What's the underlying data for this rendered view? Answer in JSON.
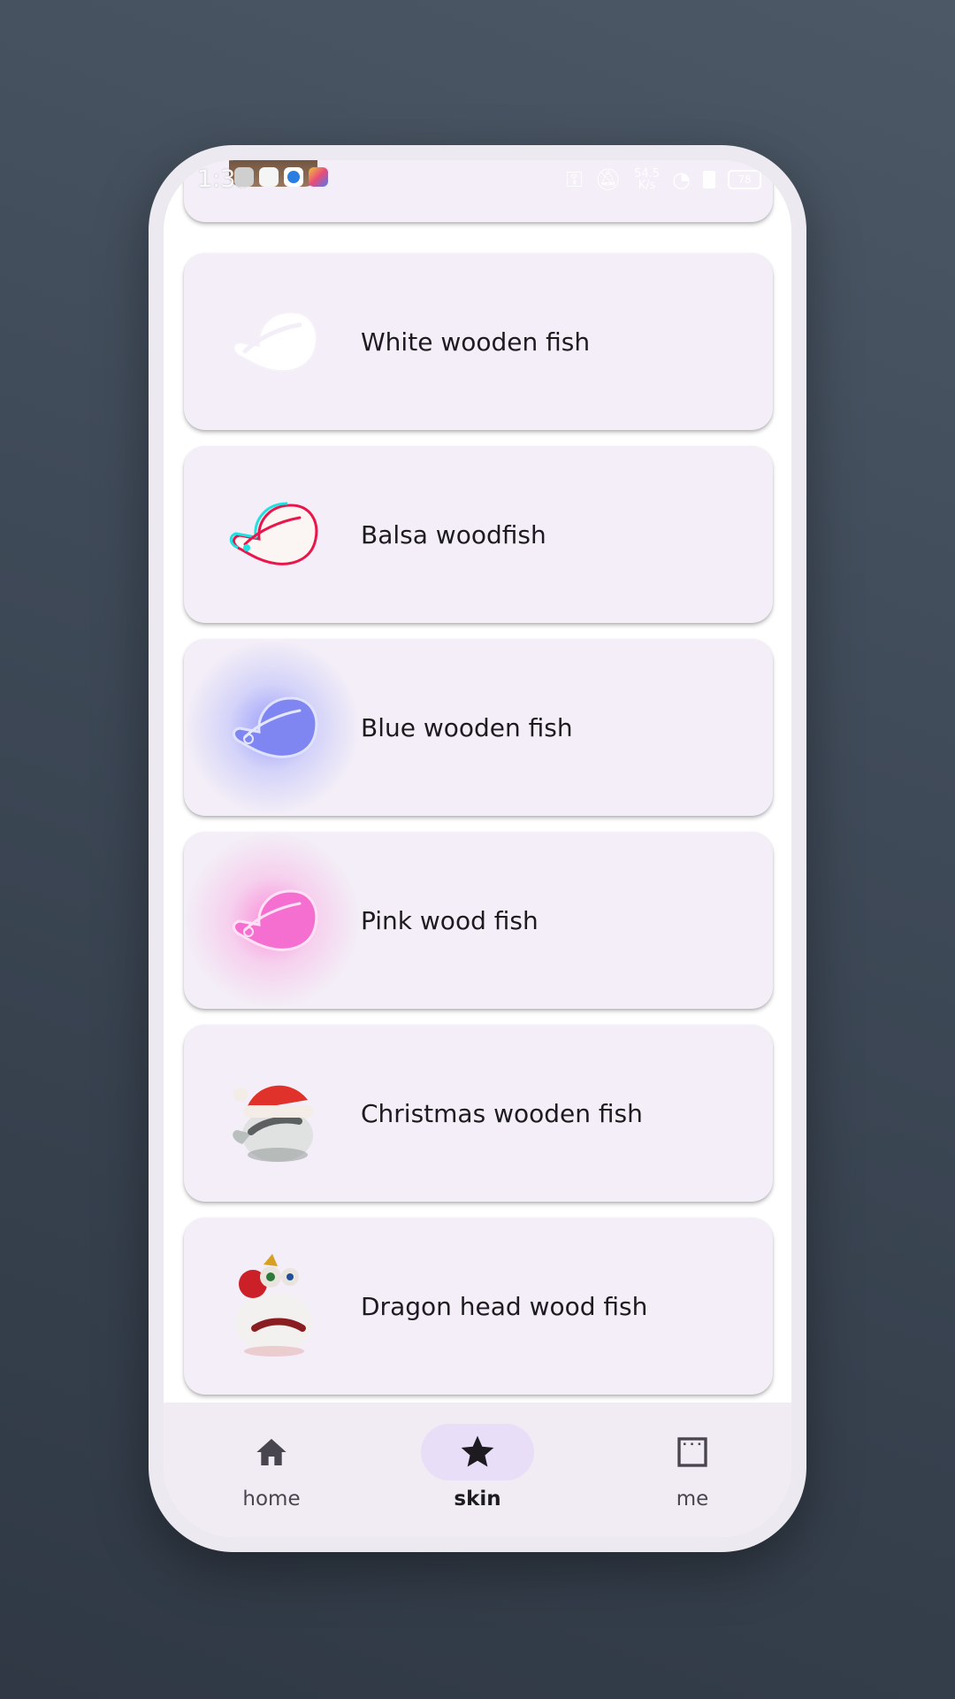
{
  "status_bar": {
    "time": "1:33",
    "network_speed_value": "54.5",
    "network_speed_unit": "K/s",
    "battery": "78"
  },
  "skins": [
    {
      "label": "White wooden fish",
      "icon": "white-wooden-fish-icon"
    },
    {
      "label": "Balsa woodfish",
      "icon": "balsa-woodfish-icon"
    },
    {
      "label": "Blue wooden fish",
      "icon": "blue-wooden-fish-icon"
    },
    {
      "label": "Pink wood fish",
      "icon": "pink-wood-fish-icon"
    },
    {
      "label": "Christmas wooden fish",
      "icon": "christmas-wooden-fish-icon"
    },
    {
      "label": "Dragon head wood fish",
      "icon": "dragon-head-wood-fish-icon"
    }
  ],
  "nav": {
    "items": [
      {
        "label": "home",
        "icon": "home-icon"
      },
      {
        "label": "skin",
        "icon": "star-icon",
        "active": true
      },
      {
        "label": "me",
        "icon": "window-icon"
      }
    ]
  },
  "colors": {
    "card_bg": "#f3eef7",
    "nav_bg": "#f1ecf4",
    "active_pill": "#e8def8",
    "text": "#1d1b20"
  }
}
